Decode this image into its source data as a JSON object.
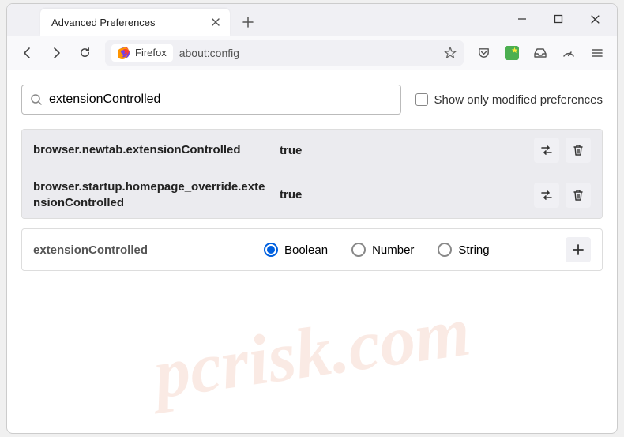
{
  "tab": {
    "title": "Advanced Preferences"
  },
  "urlbar": {
    "identity": "Firefox",
    "url": "about:config"
  },
  "search": {
    "value": "extensionControlled",
    "checkbox_label": "Show only modified preferences"
  },
  "prefs": [
    {
      "name": "browser.newtab.extensionControlled",
      "value": "true"
    },
    {
      "name": "browser.startup.homepage_override.extensionControlled",
      "value": "true"
    }
  ],
  "addRow": {
    "name": "extensionControlled",
    "types": [
      "Boolean",
      "Number",
      "String"
    ],
    "selected": "Boolean"
  },
  "watermark": "pcrisk.com"
}
